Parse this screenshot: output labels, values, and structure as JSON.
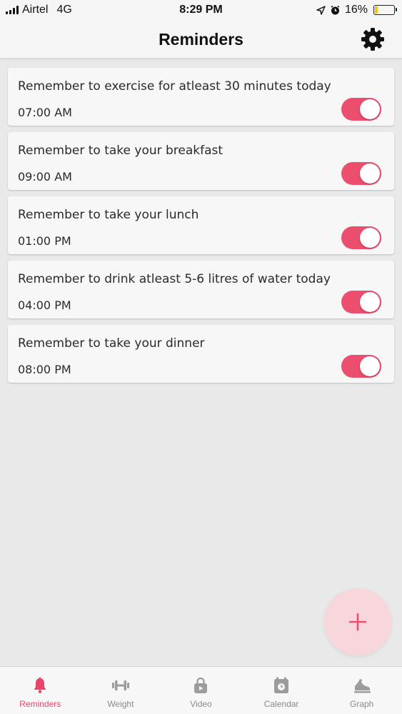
{
  "status_bar": {
    "carrier": "Airtel",
    "network": "4G",
    "time": "8:29 PM",
    "battery": "16%",
    "battery_level": 0.16,
    "battery_color": "#f1c21b"
  },
  "header": {
    "title": "Reminders",
    "settings_icon": "gear-icon"
  },
  "reminders": [
    {
      "text": "Remember to exercise for atleast 30 minutes today",
      "time": "07:00 AM",
      "enabled": true
    },
    {
      "text": "Remember to take your breakfast",
      "time": "09:00 AM",
      "enabled": true
    },
    {
      "text": "Remember to take your lunch",
      "time": "01:00 PM",
      "enabled": true
    },
    {
      "text": "Remember to drink atleast 5-6 litres of water today",
      "time": "04:00 PM",
      "enabled": true
    },
    {
      "text": "Remember to take your dinner",
      "time": "08:00 PM",
      "enabled": true
    }
  ],
  "fab": {
    "icon": "plus-icon"
  },
  "tabs": [
    {
      "label": "Reminders",
      "icon": "bell-icon",
      "active": true
    },
    {
      "label": "Weight",
      "icon": "dumbbell-icon",
      "active": false
    },
    {
      "label": "Video",
      "icon": "video-icon",
      "active": false
    },
    {
      "label": "Calendar",
      "icon": "calendar-icon",
      "active": false
    },
    {
      "label": "Graph",
      "icon": "shoe-icon",
      "active": false
    }
  ],
  "colors": {
    "accent": "#ec4f6e",
    "active_tab": "#e9446a",
    "inactive_tab": "#8a8a8c",
    "fab_background": "#f7d7dc"
  }
}
